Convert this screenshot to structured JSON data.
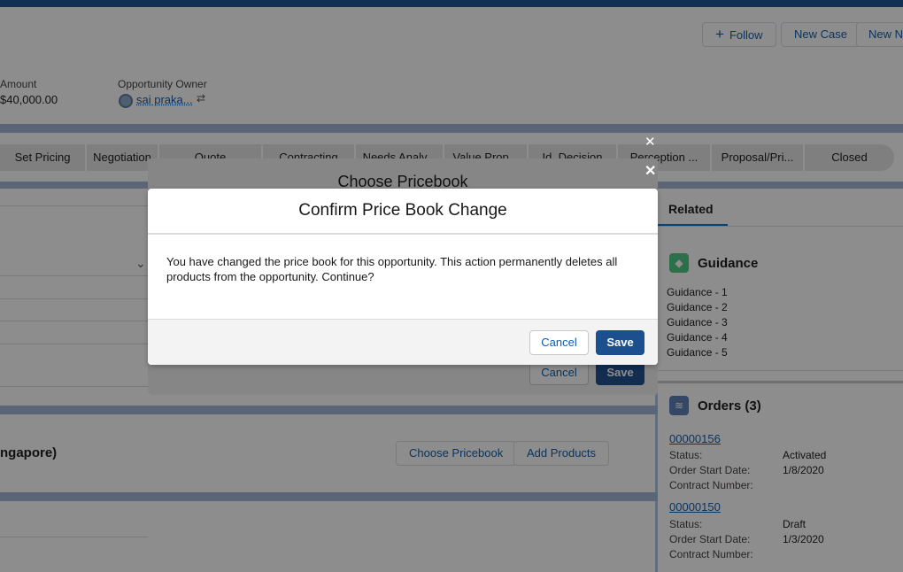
{
  "header": {
    "follow_label": "Follow",
    "new_case_label": "New Case",
    "new_n_label": "New N",
    "amount_label": "Amount",
    "amount_value": "$40,000.00",
    "owner_label": "Opportunity Owner",
    "owner_name": "sai praka..."
  },
  "path": {
    "stages": [
      "Set Pricing",
      "Negotiation",
      "Quote",
      "Contracting",
      "Needs Analy...",
      "Value Prop...",
      "Id. Decision",
      "Perception ...",
      "Proposal/Pri...",
      "Closed"
    ]
  },
  "main": {
    "subcard_title": "ngapore)",
    "choose_pricebook_label": "Choose Pricebook",
    "add_products_label": "Add Products"
  },
  "related": {
    "tab_label": "Related",
    "guidance": {
      "title": "Guidance",
      "items": [
        "Guidance - 1",
        "Guidance - 2",
        "Guidance - 3",
        "Guidance - 4",
        "Guidance - 5"
      ]
    },
    "orders": {
      "title": "Orders (3)",
      "items": [
        {
          "number": "00000156",
          "status_label": "Status:",
          "status": "Activated",
          "start_label": "Order Start Date:",
          "start": "1/8/2020",
          "contract_label": "Contract Number:"
        },
        {
          "number": "00000150",
          "status_label": "Status:",
          "status": "Draft",
          "start_label": "Order Start Date:",
          "start": "1/3/2020",
          "contract_label": "Contract Number:"
        }
      ]
    }
  },
  "choose_pricebook_modal": {
    "title": "Choose Pricebook",
    "cancel_label": "Cancel",
    "save_label": "Save",
    "close_glyph": "✕"
  },
  "confirm_modal": {
    "title": "Confirm Price Book Change",
    "body": "You have changed the price book for this opportunity. This action permanently deletes all products from the opportunity. Continue?",
    "cancel_label": "Cancel",
    "save_label": "Save",
    "close_glyph": "✕"
  },
  "colors": {
    "brand_blue": "#1b4f8e",
    "link_blue": "#0b5cab",
    "guidance_icon": "#4bca81",
    "orders_icon": "#5a7fb8"
  }
}
